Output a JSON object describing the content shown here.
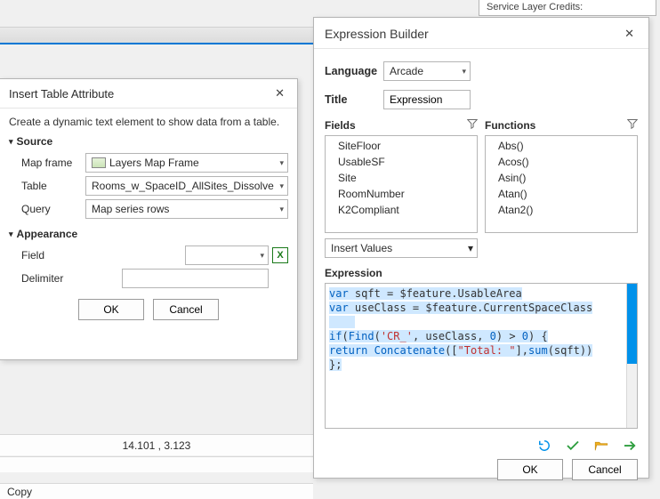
{
  "credits_stub": "Service Layer Credits:",
  "insert_panel": {
    "title": "Insert Table Attribute",
    "description": "Create a dynamic text element to show data from a table.",
    "section_source": "Source",
    "map_frame_label": "Map frame",
    "map_frame_value": "Layers Map Frame",
    "table_label": "Table",
    "table_value": "Rooms_w_SpaceID_AllSites_Dissolve",
    "query_label": "Query",
    "query_value": "Map series rows",
    "section_appearance": "Appearance",
    "field_label": "Field",
    "field_value": "",
    "delimiter_label": "Delimiter",
    "delimiter_value": "",
    "ok": "OK",
    "cancel": "Cancel"
  },
  "status": {
    "coords": "14.101 , 3.123",
    "copy": "Copy"
  },
  "expr_panel": {
    "title": "Expression Builder",
    "language_label": "Language",
    "language_value": "Arcade",
    "title_label": "Title",
    "title_value": "Expression",
    "fields_label": "Fields",
    "functions_label": "Functions",
    "fields_list": [
      "SiteFloor",
      "UsableSF",
      "Site",
      "RoomNumber",
      "K2Compliant"
    ],
    "functions_list": [
      "Abs()",
      "Acos()",
      "Asin()",
      "Atan()",
      "Atan2()"
    ],
    "insert_values": "Insert Values",
    "expression_label": "Expression",
    "code": {
      "l1a": "var",
      "l1b": " sqft = $feature.UsableArea",
      "l2a": "var",
      "l2b": " useClass = $feature.CurrentSpaceClass",
      "l4a": "if",
      "l4b": "(",
      "l4c": "Find",
      "l4d": "(",
      "l4e": "'CR_'",
      "l4f": ", useClass, ",
      "l4g": "0",
      "l4h": ") > ",
      "l4i": "0",
      "l4j": ") {",
      "l5a": "  return",
      "l5b": " ",
      "l5c": "Concatenate",
      "l5d": "([",
      "l5e": "\"Total: \"",
      "l5f": "],",
      "l5g": "sum",
      "l5h": "(sqft))",
      "l6": "  };"
    },
    "ok": "OK",
    "cancel": "Cancel"
  }
}
